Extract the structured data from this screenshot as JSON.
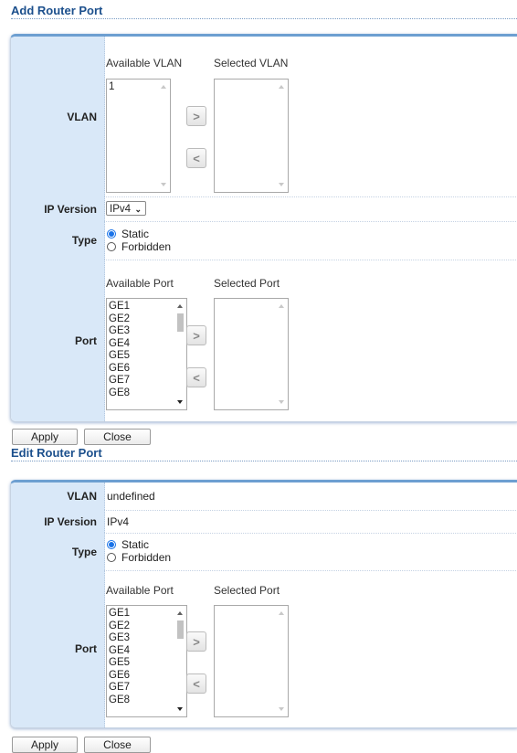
{
  "add_section": {
    "title": "Add Router Port",
    "vlan": {
      "label": "VLAN",
      "available_header": "Available VLAN",
      "selected_header": "Selected VLAN",
      "available_items": [
        "1"
      ],
      "selected_items": []
    },
    "ip_version": {
      "label": "IP Version",
      "selected": "IPv4",
      "options": [
        "IPv4"
      ]
    },
    "type": {
      "label": "Type",
      "options": [
        "Static",
        "Forbidden"
      ],
      "selected": "Static"
    },
    "port": {
      "label": "Port",
      "available_header": "Available Port",
      "selected_header": "Selected Port",
      "available_items": [
        "GE1",
        "GE2",
        "GE3",
        "GE4",
        "GE5",
        "GE6",
        "GE7",
        "GE8"
      ],
      "selected_items": []
    },
    "add_arrow": ">",
    "remove_arrow": "<",
    "apply_label": "Apply",
    "close_label": "Close"
  },
  "edit_section": {
    "title": "Edit Router Port",
    "vlan": {
      "label": "VLAN",
      "value": "undefined"
    },
    "ip_version": {
      "label": "IP Version",
      "value": "IPv4"
    },
    "type": {
      "label": "Type",
      "options": [
        "Static",
        "Forbidden"
      ],
      "selected": "Static"
    },
    "port": {
      "label": "Port",
      "available_header": "Available Port",
      "selected_header": "Selected Port",
      "available_items": [
        "GE1",
        "GE2",
        "GE3",
        "GE4",
        "GE5",
        "GE6",
        "GE7",
        "GE8"
      ],
      "selected_items": []
    },
    "add_arrow": ">",
    "remove_arrow": "<",
    "apply_label": "Apply",
    "close_label": "Close"
  }
}
